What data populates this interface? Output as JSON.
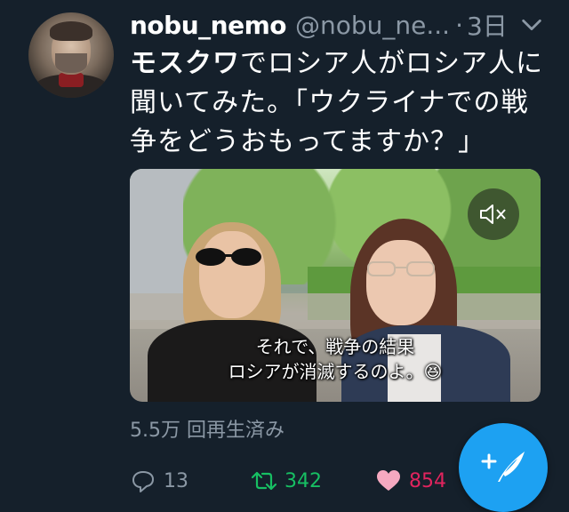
{
  "tweet": {
    "author_name": "nobu_nemo",
    "handle": "@nobu_ne...",
    "separator": "·",
    "time": "3日",
    "text_bold": "モスクワ",
    "text_rest": "でロシア人がロシア人に聞いてみた。「ウクライナでの戦争をどうおもってますか？」"
  },
  "video": {
    "subtitle_line1": "それで、戦争の結果",
    "subtitle_line2": "ロシアが消滅するのよ。😆"
  },
  "views": "5.5万 回再生済み",
  "actions": {
    "reply_count": "13",
    "retweet_count": "342",
    "like_count": "854"
  },
  "colors": {
    "background": "#15202b",
    "muted_text": "#8b98a5",
    "retweet": "#17bf63",
    "like": "#e0245e",
    "fab": "#1da1f2"
  },
  "icons": [
    "chevron-down-icon",
    "mute-icon",
    "reply-icon",
    "retweet-icon",
    "like-icon",
    "compose-icon"
  ]
}
